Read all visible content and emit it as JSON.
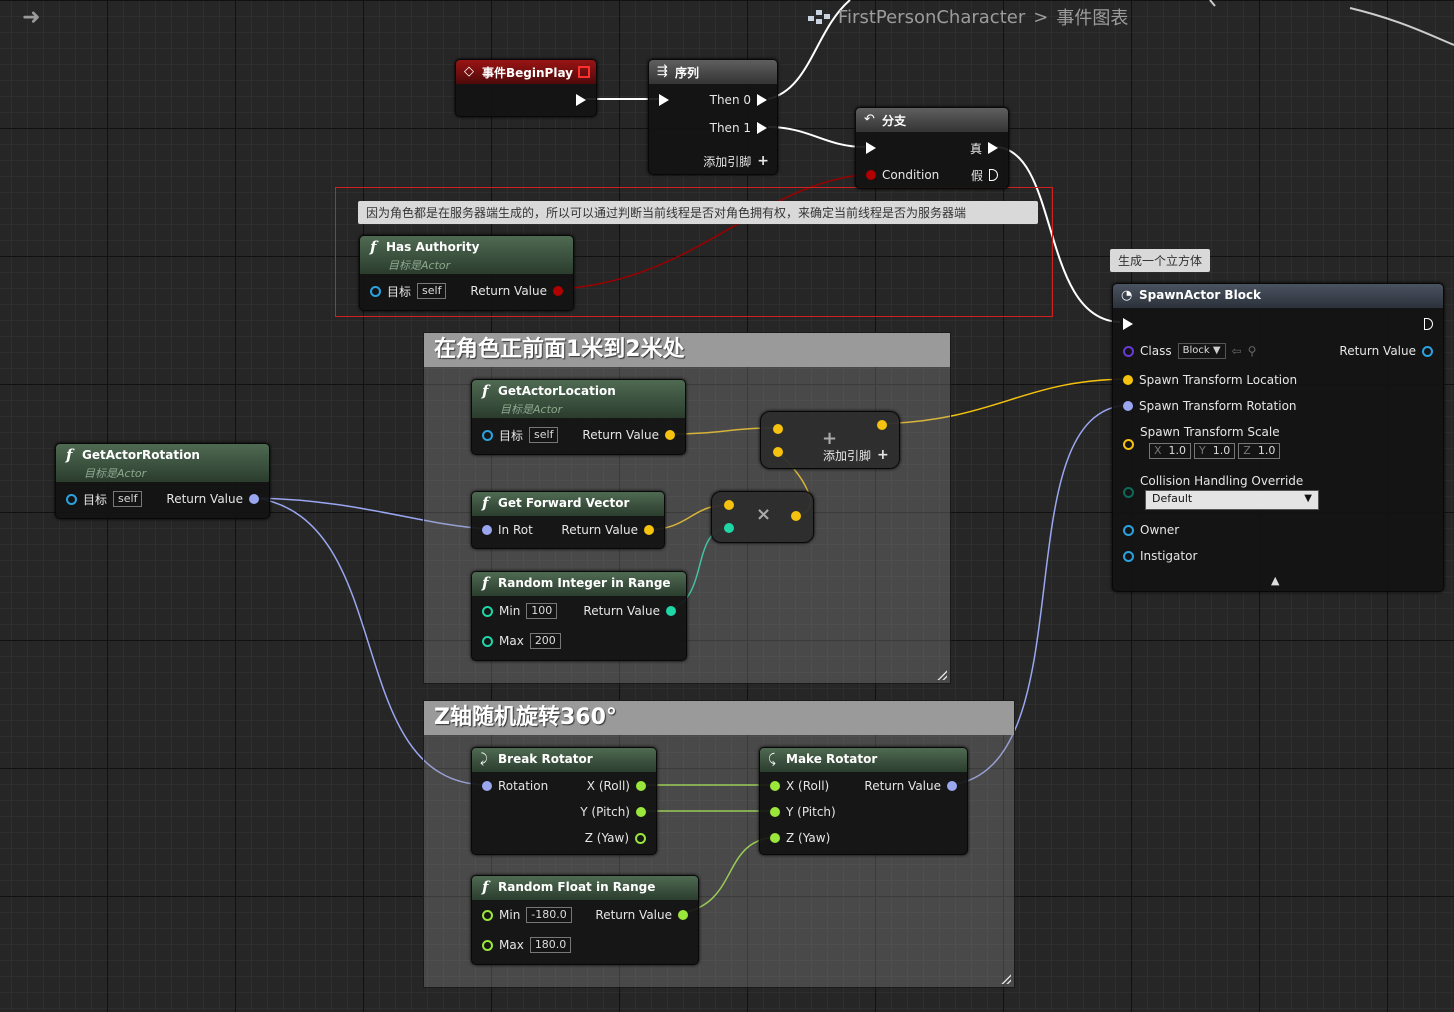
{
  "header": {
    "breadcrumb_root": "FirstPersonCharacter",
    "breadcrumb_sep": ">",
    "breadcrumb_current": "事件图表"
  },
  "comments": {
    "authority": "因为角色都是在服务器端生成的，所以可以通过判断当前线程是否对角色拥有权，来确定当前线程是否为服务器端",
    "spawn": "生成一个立方体"
  },
  "groups": {
    "front": "在角色正前面1米到2米处",
    "rotate": "Z轴随机旋转360°"
  },
  "nodes": {
    "begin_play": {
      "title": "事件BeginPlay"
    },
    "sequence": {
      "title": "序列",
      "then0": "Then 0",
      "then1": "Then 1",
      "add_pin": "添加引脚"
    },
    "branch": {
      "title": "分支",
      "condition": "Condition",
      "true_label": "真",
      "false_label": "假"
    },
    "has_authority": {
      "title": "Has Authority",
      "subtitle": "目标是Actor",
      "target": "目标",
      "self": "self",
      "ret": "Return Value"
    },
    "get_actor_rotation": {
      "title": "GetActorRotation",
      "subtitle": "目标是Actor",
      "target": "目标",
      "self": "self",
      "ret": "Return Value"
    },
    "get_actor_location": {
      "title": "GetActorLocation",
      "subtitle": "目标是Actor",
      "target": "目标",
      "self": "self",
      "ret": "Return Value"
    },
    "add": {
      "op": "+",
      "add_pin": "添加引脚"
    },
    "get_forward": {
      "title": "Get Forward Vector",
      "in_rot": "In Rot",
      "ret": "Return Value"
    },
    "multiply": {
      "op": "×"
    },
    "random_int": {
      "title": "Random Integer in Range",
      "min": "Min",
      "min_val": "100",
      "max": "Max",
      "max_val": "200",
      "ret": "Return Value"
    },
    "break_rotator": {
      "title": "Break Rotator",
      "rotation": "Rotation",
      "x": "X (Roll)",
      "y": "Y (Pitch)",
      "z": "Z (Yaw)"
    },
    "make_rotator": {
      "title": "Make Rotator",
      "x": "X (Roll)",
      "y": "Y (Pitch)",
      "z": "Z (Yaw)",
      "ret": "Return Value"
    },
    "random_float": {
      "title": "Random Float in Range",
      "min": "Min",
      "min_val": "-180.0",
      "max": "Max",
      "max_val": "180.0",
      "ret": "Return Value"
    },
    "spawn_actor": {
      "title": "SpawnActor Block",
      "class_label": "Class",
      "class_val": "Block",
      "ret": "Return Value",
      "loc": "Spawn Transform Location",
      "rot": "Spawn Transform Rotation",
      "scale": "Spawn Transform Scale",
      "sx_label": "X",
      "sx": "1.0",
      "sy_label": "Y",
      "sy": "1.0",
      "sz_label": "Z",
      "sz": "1.0",
      "collision": "Collision Handling Override",
      "collision_val": "Default",
      "owner": "Owner",
      "instigator": "Instigator"
    }
  },
  "colors": {
    "exec": "#ffffff",
    "bool": "#b00000",
    "object": "#2aa2e0",
    "vector": "#f5c20f",
    "rotator": "#9aa6f0",
    "int": "#1ed6a6",
    "float": "#9be63a",
    "class": "#6a3ad8",
    "comment_border": "#d02020"
  }
}
